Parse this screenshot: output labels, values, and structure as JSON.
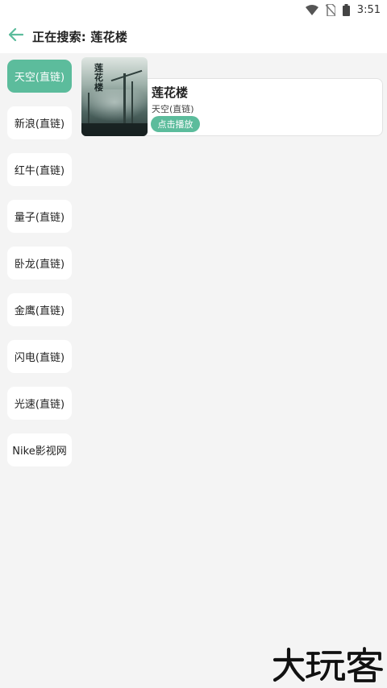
{
  "status_bar": {
    "time": "3:51",
    "icons": [
      "wifi-icon",
      "no-sim-icon",
      "battery-icon"
    ]
  },
  "header": {
    "back_icon": "back-arrow-icon",
    "title": "正在搜索: 莲花楼"
  },
  "sidebar": {
    "items": [
      {
        "label": "天空(直链)",
        "active": true
      },
      {
        "label": "新浪(直链)",
        "active": false
      },
      {
        "label": "红牛(直链)",
        "active": false
      },
      {
        "label": "量子(直链)",
        "active": false
      },
      {
        "label": "卧龙(直链)",
        "active": false
      },
      {
        "label": "金鹰(直链)",
        "active": false
      },
      {
        "label": "闪电(直链)",
        "active": false
      },
      {
        "label": "光速(直链)",
        "active": false
      },
      {
        "label": "Nike影视网",
        "active": false
      }
    ]
  },
  "results": [
    {
      "title": "莲花楼",
      "source": "天空(直链)",
      "play_label": "点击播放"
    }
  ],
  "watermark": "大玩客",
  "colors": {
    "accent": "#5cbc9c",
    "background": "#f4f4f4",
    "card": "#ffffff"
  }
}
